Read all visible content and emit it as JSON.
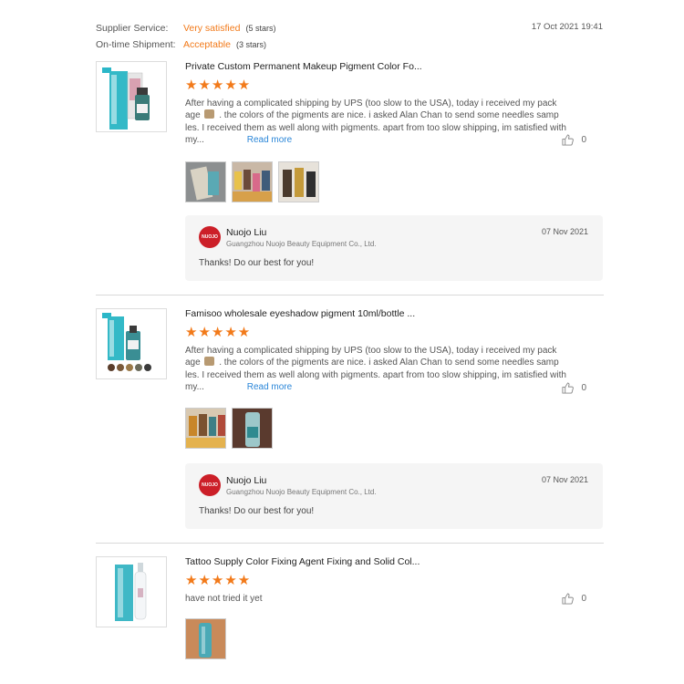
{
  "header": {
    "supplier_label": "Supplier Service:",
    "supplier_value": "Very satisfied",
    "supplier_stars": "(5 stars)",
    "shipment_label": "On-time Shipment:",
    "shipment_value": "Acceptable",
    "shipment_stars": "(3 stars)",
    "date": "17 Oct 2021 19:41"
  },
  "reviews": [
    {
      "title": "Private Custom Permanent Makeup Pigment Color Fo...",
      "stars": "★★★★★",
      "rating": 5,
      "text_a": "After having a complicated shipping by UPS (too slow to the USA), today i received my pack age",
      "text_b": ". the colors of the pigments are nice. i asked Alan Chan to send some needles samp les. I received them as well along with pigments. apart from too slow shipping, im satisfied with my...",
      "read_more": "Read more",
      "likes": "0",
      "reply": {
        "avatar": "NUOJO",
        "name": "Nuojo Liu",
        "company": "Guangzhou Nuojo Beauty Equipment Co., Ltd.",
        "date": "07 Nov 2021",
        "text": "Thanks! Do our best for you!"
      }
    },
    {
      "title": "Famisoo wholesale eyeshadow pigment 10ml/bottle ...",
      "stars": "★★★★★",
      "rating": 5,
      "text_a": "After having a complicated shipping by UPS (too slow to the USA), today i received my pack age",
      "text_b": ". the colors of the pigments are nice. i asked Alan Chan to send some needles samp les. I received them as well along with pigments. apart from too slow shipping, im satisfied with my...",
      "read_more": "Read more",
      "likes": "0",
      "reply": {
        "avatar": "NUOJO",
        "name": "Nuojo Liu",
        "company": "Guangzhou Nuojo Beauty Equipment Co., Ltd.",
        "date": "07 Nov 2021",
        "text": "Thanks! Do our best for you!"
      }
    },
    {
      "title": "Tattoo Supply Color Fixing Agent Fixing and Solid Col...",
      "stars": "★★★★★",
      "rating": 5,
      "text": "have not tried it yet",
      "likes": "0"
    }
  ],
  "colors": {
    "accent": "#f27a1a",
    "link": "#2a86d8",
    "reply_bg": "#f5f5f5",
    "avatar": "#cc1f28"
  },
  "icons": {
    "like": "thumbs-up-icon"
  }
}
